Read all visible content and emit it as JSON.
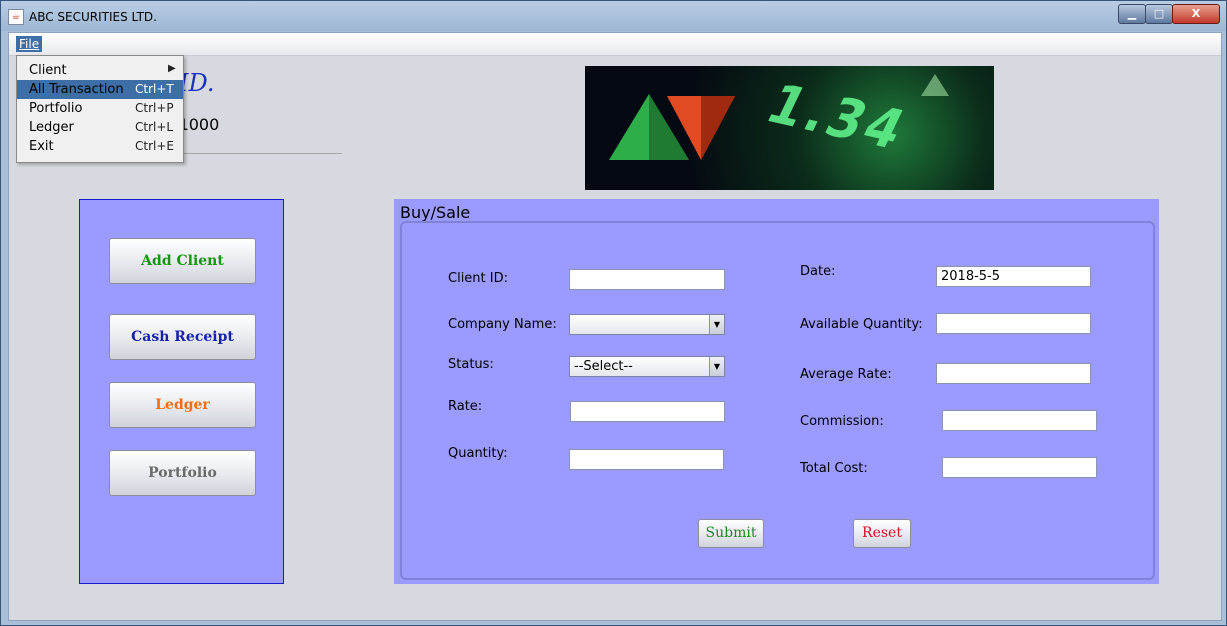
{
  "window": {
    "title": "ABC SECURITIES LTD.",
    "title_icon": "java-cup-icon",
    "controls": {
      "minimize": "▁",
      "maximize": "□",
      "close": "X"
    }
  },
  "menubar": {
    "file_label": "File",
    "dropdown": [
      {
        "label": "Client",
        "accelerator": "",
        "submenu_arrow": "▶"
      },
      {
        "label": "All Transaction",
        "accelerator": "Ctrl+T"
      },
      {
        "label": "Portfolio",
        "accelerator": "Ctrl+P"
      },
      {
        "label": "Ledger",
        "accelerator": "Ctrl+L"
      },
      {
        "label": "Exit",
        "accelerator": "Ctrl+E"
      }
    ]
  },
  "header": {
    "company_name": "IES LID.",
    "address": "ka-1000",
    "banner_text": "1.34"
  },
  "left_panel": {
    "add_client": "Add Client",
    "cash_receipt": "Cash Receipt",
    "ledger": "Ledger",
    "portfolio": "Portfolio"
  },
  "form": {
    "title": "Buy/Sale",
    "client_id_label": "Client ID:",
    "client_id_value": "",
    "company_name_label": "Company Name:",
    "company_name_value": "",
    "status_label": "Status:",
    "status_value": "--Select--",
    "rate_label": "Rate:",
    "rate_value": "",
    "quantity_label": "Quantity:",
    "quantity_value": "",
    "date_label": "Date:",
    "date_value": "2018-5-5",
    "available_quantity_label": "Available Quantity:",
    "available_quantity_value": "",
    "average_rate_label": "Average Rate:",
    "average_rate_value": "",
    "commission_label": "Commission:",
    "commission_value": "",
    "total_cost_label": "Total Cost:",
    "total_cost_value": "",
    "submit": "Submit",
    "reset": "Reset"
  },
  "colors": {
    "panel_bg": "#9a9aff",
    "add_client": "#16960f",
    "cash_receipt": "#1a23a8",
    "ledger": "#f07010",
    "portfolio": "#6a6a6a",
    "submit": "#1a8a1a",
    "reset": "#d0102a",
    "company_name": "#1f2fbf"
  }
}
